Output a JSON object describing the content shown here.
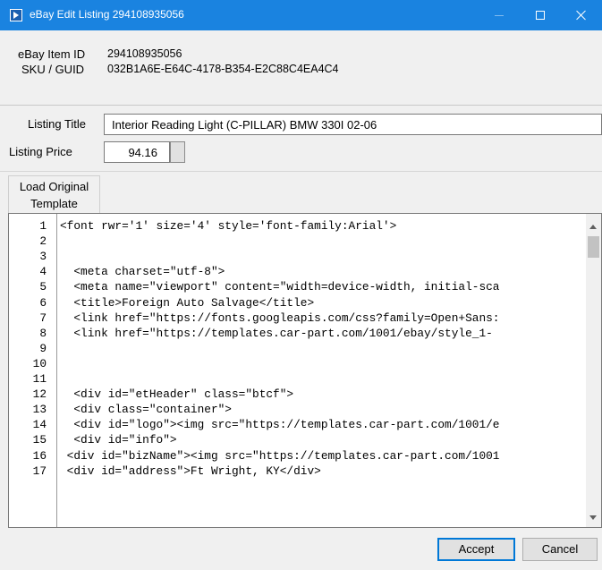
{
  "window": {
    "title": "eBay Edit Listing 294108935056"
  },
  "info": {
    "item_id_label": "eBay Item ID",
    "item_id_value": "294108935056",
    "sku_label": "SKU / GUID",
    "sku_value": "032B1A6E-E64C-4178-B354-E2C88C4EA4C4"
  },
  "form": {
    "title_label": "Listing Title",
    "title_value": "Interior Reading Light (C-PILLAR) BMW 330I 02-06",
    "price_label": "Listing Price",
    "price_value": "94.16"
  },
  "template_button": {
    "line1": "Load Original",
    "line2": "Template"
  },
  "editor": {
    "lines": [
      {
        "n": "1",
        "code": "<font rwr='1' size='4' style='font-family:Arial'>"
      },
      {
        "n": "2",
        "code": ""
      },
      {
        "n": "3",
        "code": ""
      },
      {
        "n": "4",
        "code": "  <meta charset=\"utf-8\">"
      },
      {
        "n": "5",
        "code": "  <meta name=\"viewport\" content=\"width=device-width, initial-sca"
      },
      {
        "n": "6",
        "code": "  <title>Foreign Auto Salvage</title>"
      },
      {
        "n": "7",
        "code": "  <link href=\"https://fonts.googleapis.com/css?family=Open+Sans:"
      },
      {
        "n": "8",
        "code": "  <link href=\"https://templates.car-part.com/1001/ebay/style_1-"
      },
      {
        "n": "9",
        "code": ""
      },
      {
        "n": "10",
        "code": ""
      },
      {
        "n": "11",
        "code": ""
      },
      {
        "n": "12",
        "code": "  <div id=\"etHeader\" class=\"btcf\">"
      },
      {
        "n": "13",
        "code": "  <div class=\"container\">"
      },
      {
        "n": "14",
        "code": "  <div id=\"logo\"><img src=\"https://templates.car-part.com/1001/e"
      },
      {
        "n": "15",
        "code": "  <div id=\"info\">"
      },
      {
        "n": "16",
        "code": " <div id=\"bizName\"><img src=\"https://templates.car-part.com/1001"
      },
      {
        "n": "17",
        "code": " <div id=\"address\">Ft Wright, KY</div>"
      }
    ]
  },
  "buttons": {
    "accept": "Accept",
    "cancel": "Cancel"
  }
}
